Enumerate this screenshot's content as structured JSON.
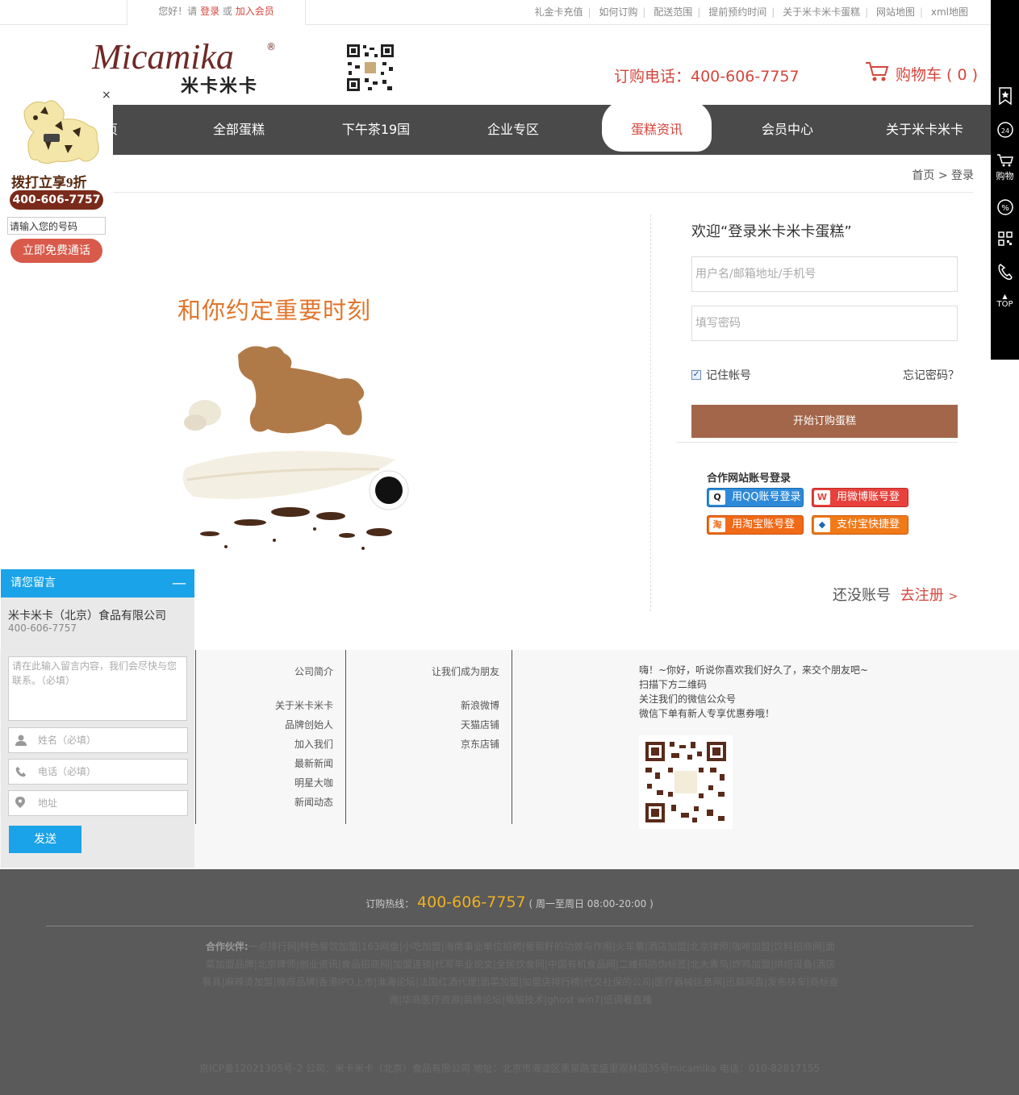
{
  "topbar": {
    "greeting_prefix": "您好！请",
    "login": "登录",
    "or": "或",
    "join": "加入会员",
    "links": [
      "礼金卡充值",
      "如何订购",
      "配送范围",
      "提前预约时间",
      "关于米卡米卡蛋糕",
      "网站地图",
      "xml地图"
    ]
  },
  "header": {
    "logo_en": "Micamika",
    "logo_reg": "®",
    "logo_cn": "米卡米卡",
    "phone": "订购电话：400-606-7757",
    "cart": "购物车 ( 0 )"
  },
  "nav": {
    "items": [
      "全部蛋糕",
      "下午茶19国",
      "企业专区",
      "蛋糕资讯",
      "会员中心",
      "关于米卡米卡"
    ],
    "active": "蛋糕资讯",
    "first_partial": "页"
  },
  "breadcrumb": {
    "home": "首页",
    "sep": ">",
    "current": "登录"
  },
  "floatad": {
    "close": "×",
    "slogan": "拨打立享9折",
    "phone": "400-606-7757",
    "input_placeholder": "请输入您的号码",
    "call_button": "立即免费通话"
  },
  "promo": {
    "slogan": "和你约定重要时刻"
  },
  "login": {
    "welcome": "欢迎“登录米卡米卡蛋糕”",
    "username_placeholder": "用户名/邮箱地址/手机号",
    "password_placeholder": "填写密码",
    "remember": "记住帐号",
    "forget": "忘记密码？",
    "submit": "开始订购蛋糕",
    "partner_title": "合作网站账号登录",
    "qq": "用QQ账号登录",
    "weibo": "用微博账号登录",
    "taobao": "用淘宝账号登录",
    "alipay": "支付宝快捷登录",
    "no_account": "还没账号",
    "register": "去注册",
    "register_arrow": ">"
  },
  "rightbar": {
    "cart_label": "购物",
    "top_label": "TOP"
  },
  "message": {
    "title": "请您留言",
    "min": "—",
    "company": "米卡米卡（北京）食品有限公司",
    "phone": "400-606-7757",
    "content_placeholder": "请在此输入留言内容，我们会尽快与您联系。（必填）",
    "name_placeholder": "姓名（必填）",
    "tel_placeholder": "电话（必填）",
    "address_placeholder": "地址",
    "send": "发送"
  },
  "footer": {
    "col1": [
      "公司简介",
      "关于米卡米卡",
      "品牌创始人",
      "加入我们",
      "最新新闻",
      "明星大咖",
      "新闻动态"
    ],
    "col2": [
      "让我们成为朋友",
      "新浪微博",
      "天猫店铺",
      "京东店铺"
    ],
    "note": [
      "嗨！~你好，听说你喜欢我们好久了，来交个朋友吧~",
      "扫描下方二维码",
      "关注我们的微信公众号",
      "微信下单有新人专享优惠券哦！"
    ],
    "hotline_label": "订购热线：",
    "hotline": "400-606-7757",
    "hotline_hours": "( 周一至周日 08:00-20:00 )",
    "partners_label": "合作伙伴:",
    "partners": "一点排行网|特色餐饮加盟|163网盘|小吃加盟|海南事业单位招聘|葡萄籽的功效与作用|火车票|酒店加盟|北京律师|咖啡加盟|饮料招商网|面菜加盟品牌|北京律师|创业资讯|食品招商网|加盟连锁|代写毕业论文|全民饮食网|中国有机食品网|二维码防伪标签|北大青鸟|炸鸡加盟|烘焙设备|酒店餐具|麻辣烫加盟|微商品牌|香港IPO上市|淮海论坛|法国红酒代理|面菜加盟|加盟店排行榜|代交社保的公司|医疗器械信息网|迅载网盘|发布快车|商标查询|华商医疗资源|装修论坛|电脑技术|ghost win7|低调看直播",
    "icp": "京ICP备12021305号-2 公司：米卡米卡（北京）食品有限公司 地址：北京市海淀区黑泉路宝盛里观林园35号micamika 电话：010-82817155"
  },
  "colors": {
    "accent_red": "#d4463c",
    "nav_bg": "#4a4a4a",
    "login_button": "#a3664a",
    "message_blue": "#1aa3e8",
    "footer_bg": "#5a5a5a",
    "hotline": "#f0b020"
  }
}
